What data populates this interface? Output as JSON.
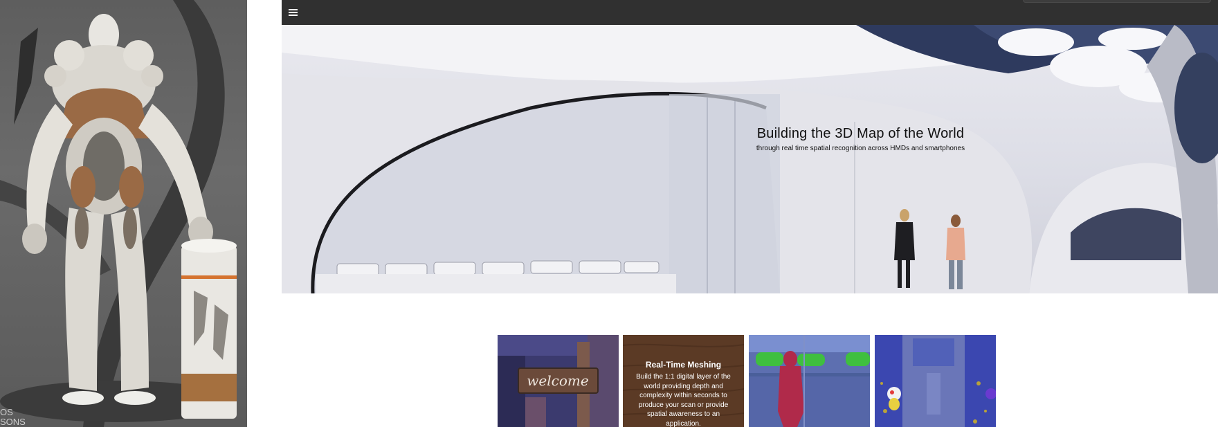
{
  "left_art": {
    "caption_line1": "OS",
    "caption_line2": "SONS"
  },
  "topbar": {
    "menu_icon": "hamburger-menu-icon"
  },
  "hero": {
    "title": "Building the 3D Map of the World",
    "subtitle": "through real time spatial recognition across HMDs and smartphones"
  },
  "tiles": [
    {
      "name": "welcome",
      "sign_text": "welcome"
    },
    {
      "name": "real-time-meshing",
      "title": "Real-Time Meshing",
      "body": "Build the 1:1 digital layer of the world providing depth and complexity within seconds to produce your scan or provide spatial awareness to an application."
    },
    {
      "name": "segmentation"
    },
    {
      "name": "ar-character"
    }
  ],
  "colors": {
    "topbar": "#303030",
    "meshing_tile": "#5b3a25"
  }
}
